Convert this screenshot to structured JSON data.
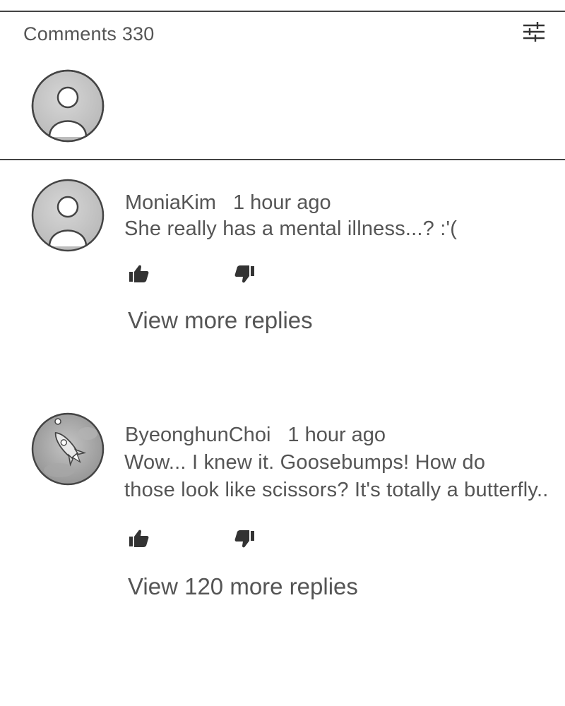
{
  "header": {
    "comments_label": "Comments 330",
    "filter_icon": "sliders-icon"
  },
  "composer": {
    "avatar_icon": "default-user-avatar-icon"
  },
  "comments": [
    {
      "username": "MoniaKim",
      "time": "1 hour ago",
      "text_lines": [
        "She really has a mental illness...? :'("
      ],
      "avatar_icon": "default-user-avatar-icon",
      "like_icon": "thumbs-up-icon",
      "dislike_icon": "thumbs-down-icon",
      "replies_label": "View more replies"
    },
    {
      "username": "ByeonghunChoi",
      "time": "1 hour ago",
      "text_lines": [
        "Wow... I knew it. Goosebumps! How do",
        "those look like scissors? It's totally a butterfly.."
      ],
      "avatar_icon": "rocket-avatar-icon",
      "like_icon": "thumbs-up-icon",
      "dislike_icon": "thumbs-down-icon",
      "replies_label": "View 120 more replies"
    }
  ],
  "colors": {
    "text": "#555555",
    "rule": "#444444",
    "avatar_fill": "#c8c8c8",
    "icon": "#333333"
  }
}
